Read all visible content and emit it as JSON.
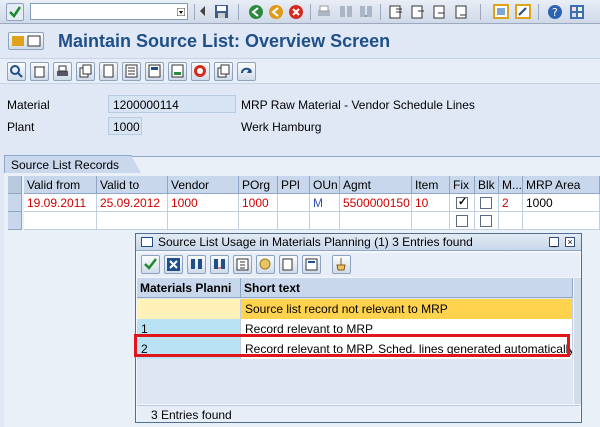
{
  "toolbar": {
    "command_field": ""
  },
  "title": "Maintain Source List: Overview Screen",
  "header": {
    "material_label": "Material",
    "material_value": "1200000114",
    "material_desc": "MRP Raw Material - Vendor Schedule Lines",
    "plant_label": "Plant",
    "plant_value": "1000",
    "plant_desc": "Werk Hamburg"
  },
  "table": {
    "title": "Source List Records",
    "columns": [
      "Valid from",
      "Valid to",
      "Vendor",
      "POrg",
      "PPl",
      "OUn",
      "Agmt",
      "Item",
      "Fix",
      "Blk",
      "M...",
      "MRP Area"
    ],
    "rows": [
      {
        "valid_from": "19.09.2011",
        "valid_to": "25.09.2012",
        "vendor": "1000",
        "porg": "1000",
        "ppl": "",
        "oun": "M",
        "agmt": "5500000150",
        "item": "10",
        "fix": true,
        "blk": false,
        "m": "2",
        "mrp_area": "1000"
      }
    ]
  },
  "popup": {
    "title": "Source List Usage in Materials Planning (1)   3 Entries found",
    "columns": [
      "Materials Planni",
      "Short text"
    ],
    "rows": [
      {
        "code": "",
        "text": "Source list record not relevant to MRP"
      },
      {
        "code": "1",
        "text": "Record relevant to MRP"
      },
      {
        "code": "2",
        "text": "Record relevant to MRP. Sched. lines generated automatically"
      }
    ],
    "status": "3 Entries found"
  },
  "colors": {
    "title": "#1f4f89",
    "red_text": "#d00000",
    "highlight": "#e0161b",
    "selected_row": "#ffd34d"
  }
}
